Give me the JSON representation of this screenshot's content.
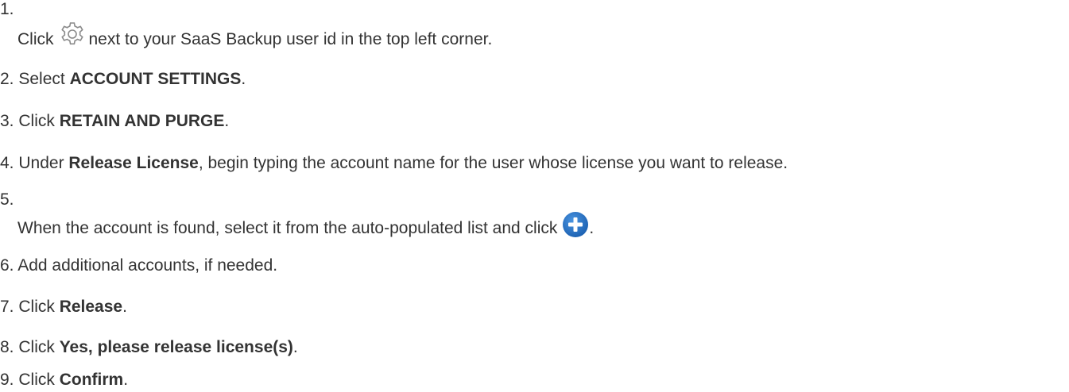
{
  "steps": [
    {
      "number": "1.",
      "before": "Click",
      "icon": "gear-icon",
      "after": "next to your SaaS Backup user id in the top left corner."
    },
    {
      "number": "2.",
      "before": "Select ",
      "bold": "ACCOUNT SETTINGS",
      "after": "."
    },
    {
      "number": "3.",
      "before": "Click ",
      "bold": "RETAIN AND PURGE",
      "after": "."
    },
    {
      "number": "4.",
      "before": "Under ",
      "bold": "Release License",
      "after": ", begin typing the account name for the user whose license you want to release."
    },
    {
      "number": "5.",
      "before": "When the account is found, select it from the auto-populated list and click",
      "icon": "plus-circle-icon",
      "after": "."
    },
    {
      "number": "6.",
      "text": "Add additional accounts, if needed."
    },
    {
      "number": "7.",
      "before": "Click ",
      "bold": "Release",
      "after": "."
    },
    {
      "number": "8.",
      "before": "Click ",
      "bold": "Yes, please release license(s)",
      "after": "."
    },
    {
      "number": "9.",
      "before": "Click ",
      "bold": "Confirm",
      "after": "."
    }
  ],
  "colors": {
    "text": "#333333",
    "gear_icon": "#8a8a8a",
    "plus_icon_fill": "#1f6fc4"
  }
}
